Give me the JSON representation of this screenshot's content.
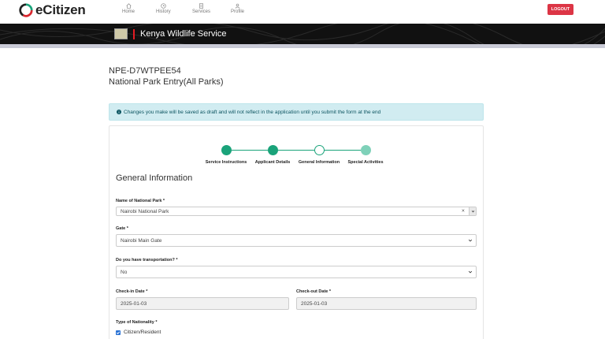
{
  "app": {
    "brand": "eCitizen"
  },
  "nav": [
    {
      "label": "Home",
      "icon": "home-icon"
    },
    {
      "label": "History",
      "icon": "history-icon"
    },
    {
      "label": "Services",
      "icon": "services-icon"
    },
    {
      "label": "Profile",
      "icon": "profile-icon"
    }
  ],
  "logout_label": "LOGOUT",
  "agency": {
    "name": "Kenya Wildlife Service"
  },
  "application": {
    "reference": "NPE-D7WTPEE54",
    "service_name": "National Park Entry(All Parks)"
  },
  "alert": {
    "text": "Changes you make will be saved as draft and will not reflect in the application until you submit the form at the end"
  },
  "stepper": {
    "steps": [
      {
        "label": "Service Instructions",
        "state": "complete"
      },
      {
        "label": "Applicant Details",
        "state": "complete"
      },
      {
        "label": "General Information",
        "state": "current"
      },
      {
        "label": "Special Activities",
        "state": "upcoming"
      }
    ]
  },
  "form": {
    "section_title": "General Information",
    "park": {
      "label": "Name of National Park *",
      "value": "Nairobi National Park"
    },
    "gate": {
      "label": "Gate *",
      "value": "Nairobi Main Gate"
    },
    "transport": {
      "label": "Do you have transportation? *",
      "value": "No"
    },
    "checkin": {
      "label": "Check-in Date *",
      "value": "2025-01-03"
    },
    "checkout": {
      "label": "Check-out Date *",
      "value": "2025-01-03"
    },
    "nationality": {
      "label": "Type of Nationality *",
      "option": "Citizen/Resident",
      "checked": true
    }
  },
  "colors": {
    "accent": "#1aa37a",
    "logout": "#dc3545",
    "alert_bg": "#d1ecf1",
    "banner": "#111111"
  }
}
